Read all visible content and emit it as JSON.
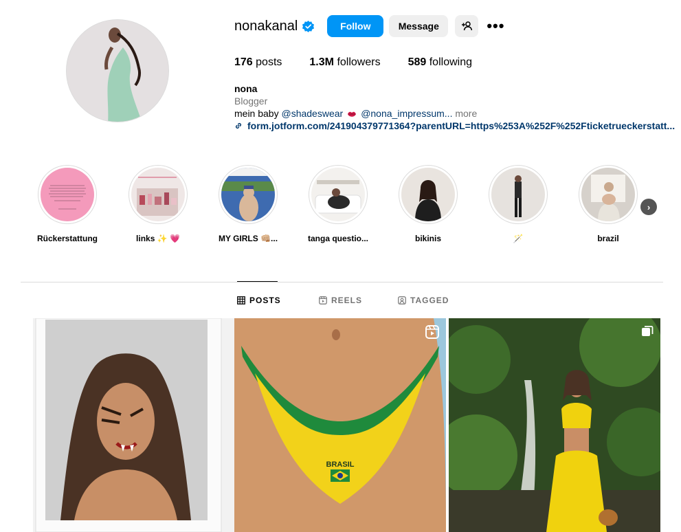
{
  "profile": {
    "username": "nonakanal",
    "verified": true,
    "follow_label": "Follow",
    "message_label": "Message",
    "stats": [
      {
        "count": "176",
        "label": "posts"
      },
      {
        "count": "1.3M",
        "label": "followers"
      },
      {
        "count": "589",
        "label": "following"
      }
    ],
    "full_name": "nona",
    "category": "Blogger",
    "bio": {
      "prefix": "mein baby ",
      "mention1": "@shadeswear",
      "mention2": "@nona_impressum...",
      "more": " more"
    },
    "link": "form.jotform.com/241904379771364?parentURL=https%253A%252F%252Fticketrueckerstatt..."
  },
  "highlights": [
    {
      "label": "Rückerstattung"
    },
    {
      "label": "links ✨ 💗"
    },
    {
      "label": "MY GIRLS 👊🏼..."
    },
    {
      "label": "tanga questio..."
    },
    {
      "label": "bikinis"
    },
    {
      "label": "🪄"
    },
    {
      "label": "brazil"
    }
  ],
  "tabs": [
    {
      "label": "POSTS",
      "active": true
    },
    {
      "label": "REELS",
      "active": false
    },
    {
      "label": "TAGGED",
      "active": false
    }
  ],
  "posts": [
    {
      "type": "image",
      "badge": "none"
    },
    {
      "type": "reel",
      "badge": "reel-icon",
      "overlay_text": "BRASIL"
    },
    {
      "type": "carousel",
      "badge": "carousel-icon"
    }
  ],
  "colors": {
    "accent": "#0095f6",
    "secondary_button": "#efefef",
    "link": "#00376b",
    "muted": "#737373",
    "border": "#dbdbdb"
  }
}
